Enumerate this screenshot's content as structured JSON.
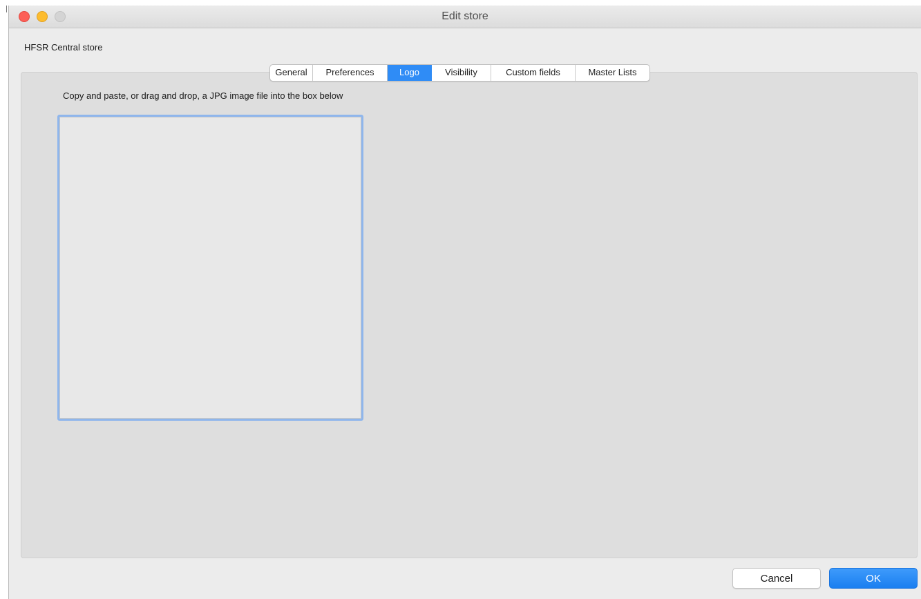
{
  "window": {
    "title": "Edit store"
  },
  "store": {
    "name": "HFSR Central store"
  },
  "tabs": [
    {
      "label": "General",
      "active": false
    },
    {
      "label": "Preferences",
      "active": false
    },
    {
      "label": "Logo",
      "active": true
    },
    {
      "label": "Visibility",
      "active": false
    },
    {
      "label": "Custom fields",
      "active": false
    },
    {
      "label": "Master Lists",
      "active": false
    }
  ],
  "logo": {
    "instruction": "Copy and paste, or drag and drop, a JPG image file into the box below"
  },
  "buttons": {
    "cancel": "Cancel",
    "ok": "OK"
  },
  "colors": {
    "accent": "#2f8cf6",
    "close": "#fc5f57",
    "minimize": "#fdbc2e",
    "zoom_disabled": "#d4d4d4"
  }
}
